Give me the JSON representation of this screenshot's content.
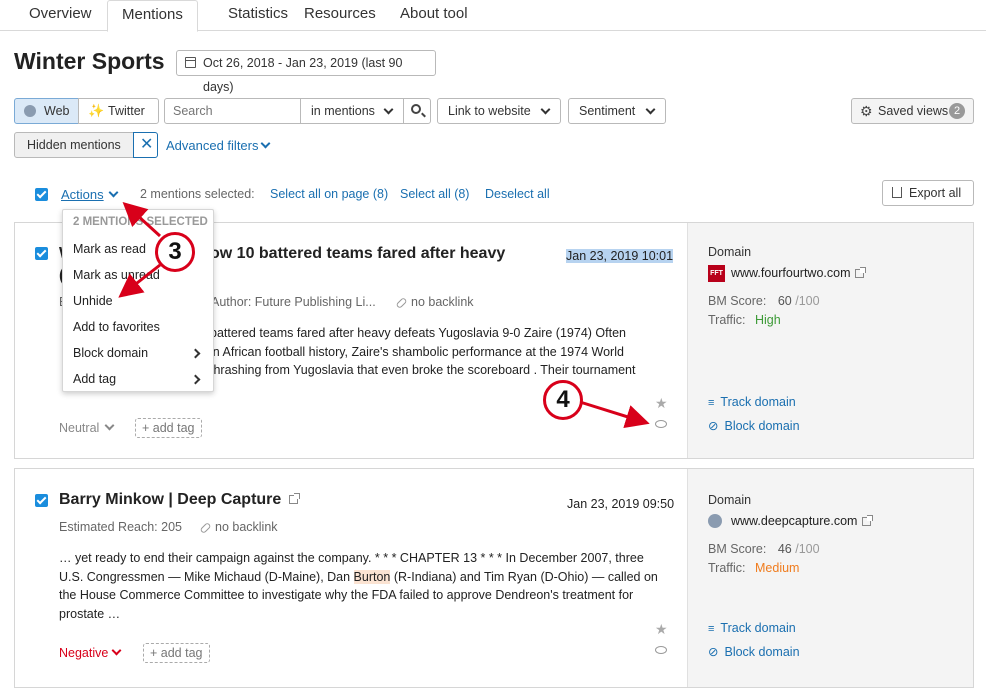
{
  "tabs": [
    "Overview",
    "Mentions",
    "Statistics",
    "Resources",
    "About tool"
  ],
  "page_title": "Winter Sports",
  "date_range": "Oct 26, 2018 - Jan 23, 2019 (last 90 days)",
  "source_toggle": {
    "web": "Web",
    "twitter": "Twitter"
  },
  "search": {
    "placeholder": "Search",
    "scope": "in mentions"
  },
  "filters": {
    "link_to_website": "Link to website",
    "sentiment": "Sentiment",
    "saved_views": "Saved views",
    "saved_views_count": "2",
    "hidden_mentions": "Hidden mentions",
    "advanced_filters": "Advanced filters"
  },
  "selection_bar": {
    "actions": "Actions",
    "selected_count": "2 mentions selected:",
    "select_all_page": "Select all on page (8)",
    "select_all": "Select all (8)",
    "deselect_all": "Deselect all",
    "export_all": "Export all"
  },
  "actions_menu": {
    "header": "2 MENTIONS SELECTED",
    "items": [
      "Mark as read",
      "Mark as unread",
      "Unhide",
      "Add to favorites",
      "Block domain",
      "Add tag"
    ]
  },
  "callouts": [
    "3",
    "4"
  ],
  "mentions": [
    {
      "title_visible": "ow 10 battered teams fared after heavy",
      "date": "Jan 23, 2019 10:01",
      "author": "Author: Future Publishing Li...",
      "backlink": "no backlink",
      "snippet": [
        "battered teams fared after heavy defeats Yugoslavia 9-0 Zaire (1974) Often",
        "in African football history, Zaire's shambolic performance at the 1974 World",
        "thrashing from Yugoslavia that even broke the scoreboard . Their tournament"
      ],
      "sentiment": "Neutral",
      "add_tag": "add tag",
      "domain_label": "Domain",
      "domain": "www.fourfourtwo.com",
      "favicon_text": "FFT",
      "bm_score_label": "BM Score:",
      "bm_score": "60",
      "bm_score_max": "/100",
      "traffic_label": "Traffic:",
      "traffic": "High",
      "track_domain": "Track domain",
      "block_domain": "Block domain"
    },
    {
      "title": "Barry Minkow | Deep Capture",
      "date": "Jan 23, 2019 09:50",
      "reach": "Estimated Reach: 205",
      "backlink": "no backlink",
      "snippet": [
        "… yet ready to end their campaign against the company. * * * CHAPTER 13 * * * In December 2007, three",
        "U.S. Congressmen — Mike Michaud (D-Maine), Dan ",
        "Burton",
        " (R-Indiana) and Tim Ryan (D-Ohio) — called on",
        "the House Commerce Committee to investigate why the FDA failed to approve Dendreon's treatment for",
        "prostate …"
      ],
      "sentiment": "Negative",
      "add_tag": "add tag",
      "domain_label": "Domain",
      "domain": "www.deepcapture.com",
      "bm_score_label": "BM Score:",
      "bm_score": "46",
      "bm_score_max": "/100",
      "traffic_label": "Traffic:",
      "traffic": "Medium",
      "track_domain": "Track domain",
      "block_domain": "Block domain"
    }
  ],
  "colors": {
    "accent": "#1a6fb0",
    "high": "#3c9a36",
    "medium": "#f07c1e",
    "negative": "#d8001a",
    "callout": "#d8001a"
  }
}
